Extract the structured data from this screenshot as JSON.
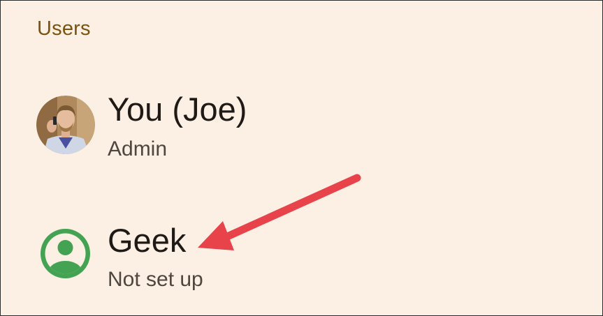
{
  "section": {
    "title": "Users"
  },
  "users": [
    {
      "name": "You (Joe)",
      "status": "Admin",
      "avatar_icon": "profile-photo"
    },
    {
      "name": "Geek",
      "status": "Not set up",
      "avatar_icon": "account-circle-icon"
    }
  ],
  "colors": {
    "background": "#fcefe3",
    "header_text": "#7a5310",
    "avatar_green": "#43a352",
    "annotation_arrow": "#e8424a"
  }
}
